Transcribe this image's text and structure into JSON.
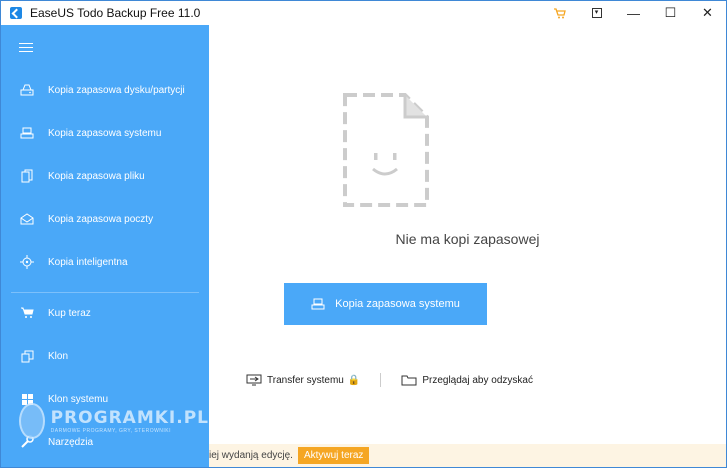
{
  "window": {
    "title": "EaseUS Todo Backup Free 11.0",
    "controls": {
      "minimize": "—",
      "maximize": "☐",
      "close": "✕"
    }
  },
  "sidebar": {
    "items": [
      {
        "label": "Kopia zapasowa dysku/partycji",
        "icon": "disk-backup-icon"
      },
      {
        "label": "Kopia zapasowa systemu",
        "icon": "system-backup-icon"
      },
      {
        "label": "Kopia zapasowa pliku",
        "icon": "file-backup-icon"
      },
      {
        "label": "Kopia zapasowa poczty",
        "icon": "mail-backup-icon"
      },
      {
        "label": "Kopia inteligentna",
        "icon": "smart-backup-icon"
      },
      {
        "label": "Kup teraz",
        "icon": "cart-icon"
      },
      {
        "label": "Klon",
        "icon": "clone-icon"
      },
      {
        "label": "Klon systemu",
        "icon": "system-clone-icon"
      },
      {
        "label": "Narzędzia",
        "icon": "tools-icon"
      }
    ]
  },
  "main": {
    "empty_text": "Nie ma kopi zapasowej",
    "primary_button": "Kopia zapasowa systemu",
    "links": {
      "transfer": "Transfer systemu",
      "browse": "Przeglądaj aby odzyskać"
    }
  },
  "footer": {
    "text": "iej wydanją edycję.",
    "activate_button": "Aktywuj teraz"
  },
  "watermark": {
    "title": "PROGRAMKI.PL",
    "subtitle": "DARMOWE PROGRAMY, GRY, STEROWNIKI"
  },
  "colors": {
    "sidebar": "#4aa8f8",
    "accent": "#4aa8f8",
    "warning": "#f5a623"
  }
}
